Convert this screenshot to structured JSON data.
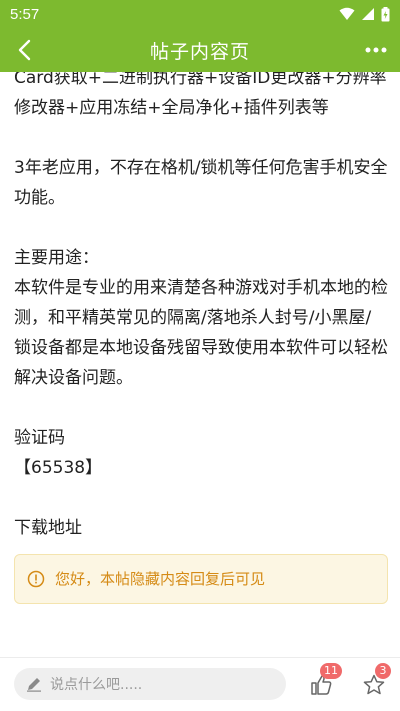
{
  "status_bar": {
    "time": "5:57"
  },
  "app_bar": {
    "title": "帖子内容页"
  },
  "post": {
    "lines": [
      "Card获取+二进制执行器+设备ID更改器+分辨率修改器+应用冻结+全局净化+插件列表等",
      "",
      "3年老应用，不存在格机/锁机等任何危害手机安全功能。",
      "",
      "主要用途：",
      "本软件是专业的用来清楚各种游戏对手机本地的检测，和平精英常见的隔离/落地杀人封号/小黑屋/锁设备都是本地设备残留导致使用本软件可以轻松解决设备问题。",
      "",
      "验证码",
      "【65538】",
      "",
      "下载地址"
    ],
    "hidden_notice": "您好，本帖隐藏内容回复后可见"
  },
  "bottom_bar": {
    "comment_placeholder": "说点什么吧.....",
    "like_count": "11",
    "favorite_count": "3"
  },
  "colors": {
    "accent": "#7dba2f",
    "badge": "#f06a6a",
    "notice_text": "#d58b16",
    "notice_bg": "#fcf6e3"
  }
}
